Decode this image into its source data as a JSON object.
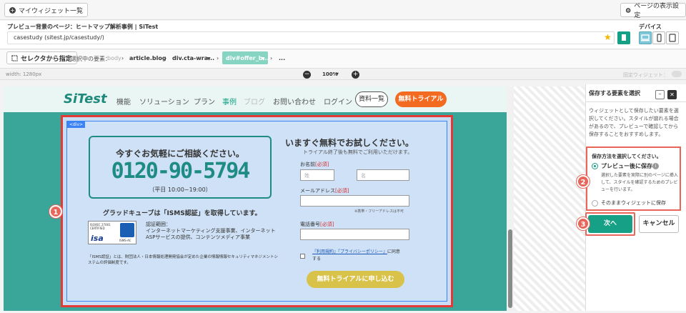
{
  "top": {
    "widget_list_label": "マイウィジェット一覧",
    "display_settings_label": "ページの表示設定"
  },
  "url": {
    "page_label": "プレビュー背景のページ：ヒートマップ解析事例 | SiTest",
    "value": "casestudy (sitest.jp/casestudy/)",
    "device_label": "デバイス"
  },
  "selector": {
    "button_label": "セレクタから指定",
    "selected_label": "選択中の要素：",
    "crumbs": [
      "body",
      "article.blog",
      "div.cta-wra...",
      "div#offer_b...",
      "..."
    ]
  },
  "zoom": {
    "width_label": "width: 1280px",
    "zoom_value": "100%",
    "fixed_widget_label": "固定ウィジェット："
  },
  "site": {
    "logo": "SiTest",
    "nav": [
      "機能",
      "ソリューション",
      "プラン",
      "事例",
      "ブログ",
      "お問い合わせ",
      "ログイン"
    ],
    "materials_button": "資料一覧",
    "trial_button": "無料トライアル"
  },
  "offer": {
    "div_tag": "<div>",
    "consult_title": "今すぐお気軽にご相談ください。",
    "phone": "0120-90-5794",
    "hours": "（平日 10:00~19:00）",
    "isms_title": "グラッドキューブは「ISMS認証」を取得しています。",
    "scope_label": "認証範囲：",
    "scope_line1": "インターネットマーケティング支援事業、インターネット",
    "scope_line2": "ASPサービスの提供、コンテンツメディア事業",
    "isms_note": "「ISMS認証」とは、財団法人・日本情報処理開発協会が定めた企業の情報情報セキュリティマネジメントシステムの評価制度です。",
    "isms_logo_text": "ISO/IEC 27001 CERTIFIED",
    "isms_ac_text": "ISMS-AC",
    "form_title": "いますぐ無料でお試しください。",
    "form_sub": "トライアル終了後も無料でご利用いただけます。",
    "name_label": "お名前",
    "required": "[必須]",
    "last_name_ph": "姓",
    "first_name_ph": "名",
    "email_label": "メールアドレス",
    "email_note": "※携帯・フリーアドレスは不可",
    "phone_label": "電話番号",
    "terms_link": "『利用規約』",
    "privacy_link": "『プライバシーポリシー』",
    "agree_text": "に同意する",
    "submit_label": "無料トライアルに申し込む"
  },
  "panel": {
    "title": "保存する要素を選択",
    "desc": "ウィジェットとして保存したい要素を選択してください。スタイルが崩れる場合があるので、プレビューで確認してから保存することをおすすめします。",
    "method_title": "保存方法を選択してください。",
    "option1": "プレビュー後に保存",
    "option1_desc": "選択した要素を実際に別のページに挿入して、スタイルを確認するためのプレビューを行います。",
    "option2": "そのままウィジェットに保存",
    "next_label": "次へ",
    "cancel_label": "キャンセル"
  },
  "badges": [
    "1",
    "2",
    "3"
  ],
  "colors": {
    "accent": "#16a085",
    "trial_orange": "#f26b21",
    "highlight_red": "#e53935",
    "badge": "#e8655a",
    "phone_teal": "#1e8c84",
    "submit_gold": "#d8c24a"
  }
}
